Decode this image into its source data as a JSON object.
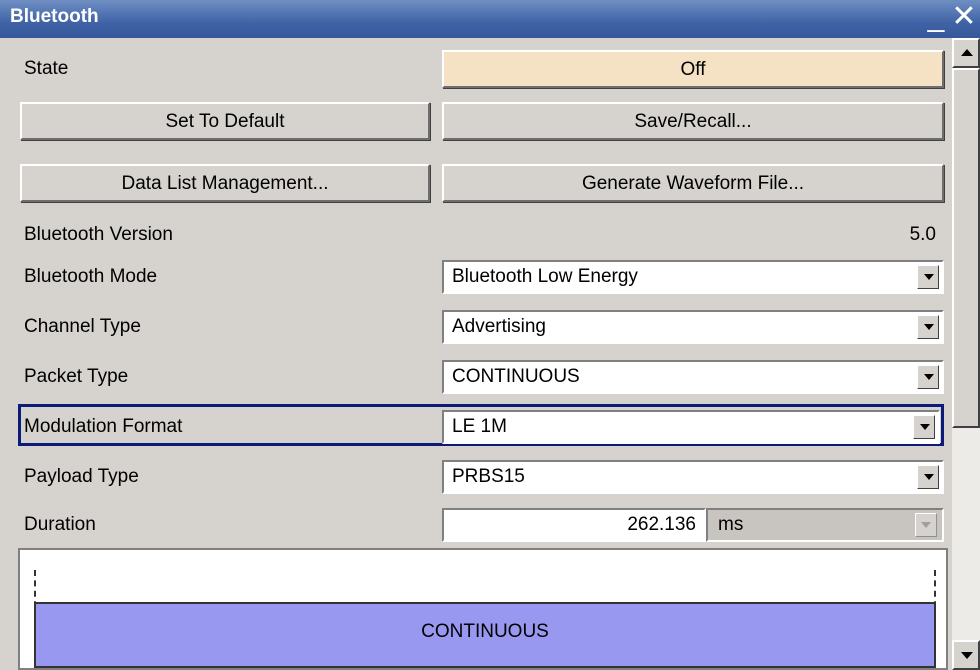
{
  "window": {
    "title": "Bluetooth",
    "minimize_glyph": "_",
    "close_glyph": "✕"
  },
  "rows": {
    "state": {
      "label": "State",
      "value": "Off"
    },
    "set_default": {
      "label": "Set To Default"
    },
    "save_recall": {
      "label": "Save/Recall..."
    },
    "data_list": {
      "label": "Data List Management..."
    },
    "gen_waveform": {
      "label": "Generate Waveform File..."
    },
    "version": {
      "label": "Bluetooth Version",
      "value": "5.0"
    },
    "mode": {
      "label": "Bluetooth Mode",
      "value": "Bluetooth Low Energy"
    },
    "channel": {
      "label": "Channel Type",
      "value": "Advertising"
    },
    "packet": {
      "label": "Packet Type",
      "value": "CONTINUOUS"
    },
    "modulation": {
      "label": "Modulation Format",
      "value": "LE 1M"
    },
    "payload": {
      "label": "Payload Type",
      "value": "PRBS15"
    },
    "duration": {
      "label": "Duration",
      "value": "262.136",
      "unit": "ms"
    }
  },
  "diagram": {
    "packet_label": "CONTINUOUS"
  },
  "colors": {
    "title_bar": "#3f63a6",
    "state_button": "#f5e1c3",
    "packet_fill": "#9898f0",
    "highlight_border": "#0c1a7a"
  },
  "icons": {
    "minimize": "minimize-icon",
    "close": "close-icon",
    "dropdown": "chevron-down-icon",
    "scroll_up": "arrow-up-icon",
    "scroll_down": "arrow-down-icon"
  }
}
